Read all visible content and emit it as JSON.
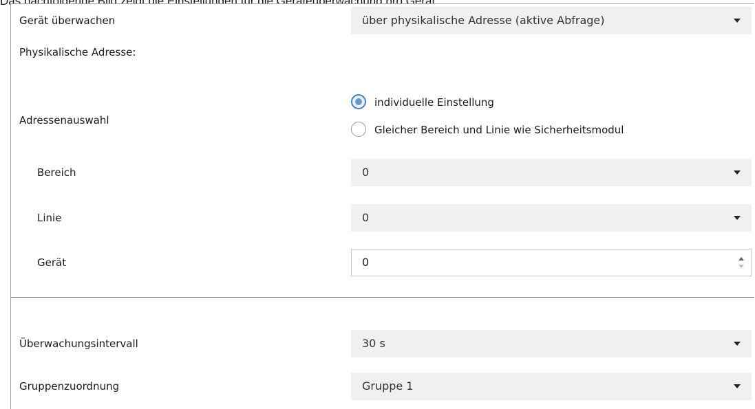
{
  "caption": "Das nachfolgende Bild zeigt die Einstellungen für die Geräteüberwachung pro Gerät:",
  "rows": {
    "monitor": {
      "label": "Gerät überwachen",
      "value": "über physikalische Adresse (aktive Abfrage)"
    },
    "phys_heading": {
      "label": "Physikalische Adresse:"
    },
    "address_selection": {
      "label": "Adressenauswahl",
      "options": [
        {
          "label": "individuelle Einstellung",
          "selected": true
        },
        {
          "label": "Gleicher Bereich und Linie wie Sicherheitsmodul",
          "selected": false
        }
      ]
    },
    "area": {
      "label": "Bereich",
      "value": "0"
    },
    "line": {
      "label": "Linie",
      "value": "0"
    },
    "device": {
      "label": "Gerät",
      "value": "0"
    },
    "interval": {
      "label": "Überwachungsintervall",
      "value": "30 s"
    },
    "group": {
      "label": "Gruppenzuordnung",
      "value": "Gruppe 1"
    }
  },
  "colors": {
    "radio_accent": "#3f82c7",
    "dropdown_bg": "#f0f0f0",
    "panel_border": "#9aa6b2"
  },
  "icons": {
    "dropdown": "chevron-down-icon",
    "spinner": "spinner-arrows-icon"
  }
}
